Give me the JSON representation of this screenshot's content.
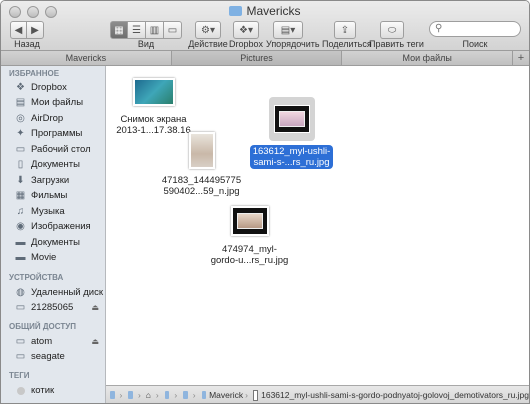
{
  "window": {
    "title": "Mavericks"
  },
  "toolbar": {
    "back_label": "Назад",
    "view_label": "Вид",
    "action_label": "Действие",
    "dropbox_label": "Dropbox",
    "arrange_label": "Упорядочить",
    "share_label": "Поделиться",
    "tags_label": "Править теги",
    "search_label": "Поиск"
  },
  "tabs": [
    "Mavericks",
    "Pictures",
    "Мои файлы"
  ],
  "sidebar": {
    "favorites_header": "ИЗБРАННОЕ",
    "favorites": [
      {
        "label": "Dropbox",
        "icon": "dropbox-icon"
      },
      {
        "label": "Мои файлы",
        "icon": "all-files-icon"
      },
      {
        "label": "AirDrop",
        "icon": "airdrop-icon"
      },
      {
        "label": "Программы",
        "icon": "applications-icon"
      },
      {
        "label": "Рабочий стол",
        "icon": "desktop-icon"
      },
      {
        "label": "Документы",
        "icon": "documents-icon"
      },
      {
        "label": "Загрузки",
        "icon": "downloads-icon"
      },
      {
        "label": "Фильмы",
        "icon": "movies-icon"
      },
      {
        "label": "Музыка",
        "icon": "music-icon"
      },
      {
        "label": "Изображения",
        "icon": "pictures-icon"
      },
      {
        "label": "Документы",
        "icon": "folder-icon"
      },
      {
        "label": "Movie",
        "icon": "folder-icon"
      }
    ],
    "devices_header": "УСТРОЙСТВА",
    "devices": [
      {
        "label": "Удаленный диск",
        "icon": "remote-disc-icon"
      },
      {
        "label": "21285065",
        "icon": "disk-icon"
      }
    ],
    "shared_header": "ОБЩИЙ ДОСТУП",
    "shared": [
      {
        "label": "atom",
        "icon": "computer-icon"
      },
      {
        "label": "seagate",
        "icon": "computer-icon"
      }
    ],
    "tags_header": "ТЕГИ",
    "tags": [
      {
        "label": "котик",
        "color": "#c8c8c8"
      }
    ]
  },
  "files": [
    {
      "line1": "Снимок экрана",
      "line2": "2013-1...17.38.16",
      "selected": false
    },
    {
      "line1": "47183_144495775",
      "line2": "590402...59_n.jpg",
      "selected": false
    },
    {
      "line1": "163612_myl-ushli-",
      "line2": "sami-s-...rs_ru.jpg",
      "selected": true
    },
    {
      "line1": "474974_myl-",
      "line2": "gordo-u...rs_ru.jpg",
      "selected": false
    }
  ],
  "path_bar": {
    "current": "Maverick",
    "file": "163612_myl-ushli-sami-s-gordo-podnyatoj-golovoj_demotivators_ru.jpg"
  },
  "colors": {
    "selection": "#2d6fd6",
    "sidebar_bg": "#e2e7ed"
  }
}
